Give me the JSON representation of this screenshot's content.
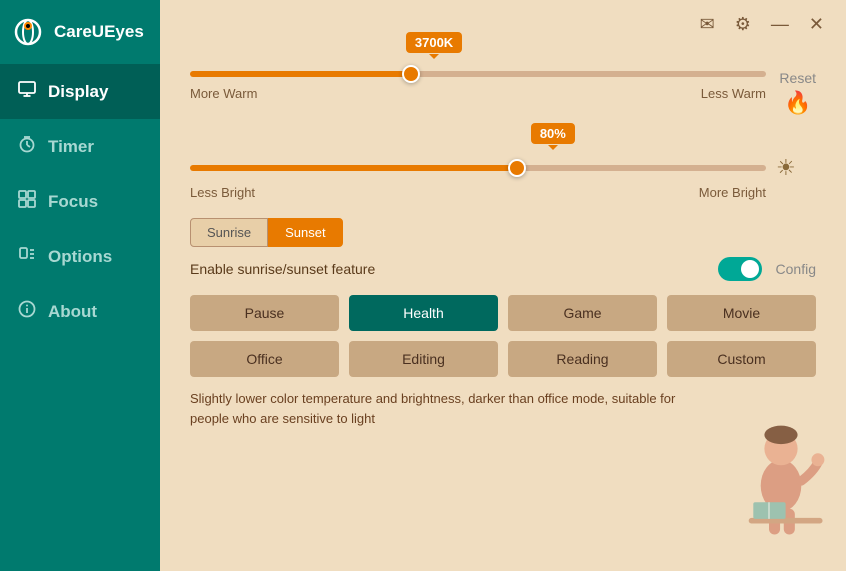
{
  "app": {
    "title": "CareUEyes"
  },
  "sidebar": {
    "items": [
      {
        "id": "display",
        "label": "Display",
        "icon": "🖥",
        "active": true
      },
      {
        "id": "timer",
        "label": "Timer",
        "icon": "🕐",
        "active": false
      },
      {
        "id": "focus",
        "label": "Focus",
        "icon": "⊞",
        "active": false
      },
      {
        "id": "options",
        "label": "Options",
        "icon": "🖱",
        "active": false
      },
      {
        "id": "about",
        "label": "About",
        "icon": "ℹ",
        "active": false
      }
    ]
  },
  "titlebar": {
    "mail_label": "✉",
    "settings_label": "⚙",
    "minimize_label": "—",
    "close_label": "✕"
  },
  "display": {
    "temp_bubble": "3700K",
    "temp_label_warm": "More Warm",
    "temp_label_less": "Less Warm",
    "bright_bubble": "80%",
    "bright_label_less": "Less Bright",
    "bright_label_more": "More Bright",
    "reset_label": "Reset",
    "sunrise_btn": "Sunrise",
    "sunset_btn": "Sunset",
    "enable_label": "Enable sunrise/sunset feature",
    "config_label": "Config",
    "modes": [
      {
        "id": "pause",
        "label": "Pause",
        "active": false
      },
      {
        "id": "health",
        "label": "Health",
        "active": true
      },
      {
        "id": "game",
        "label": "Game",
        "active": false
      },
      {
        "id": "movie",
        "label": "Movie",
        "active": false
      },
      {
        "id": "office",
        "label": "Office",
        "active": false
      },
      {
        "id": "editing",
        "label": "Editing",
        "active": false
      },
      {
        "id": "reading",
        "label": "Reading",
        "active": false
      },
      {
        "id": "custom",
        "label": "Custom",
        "active": false
      }
    ],
    "description": "Slightly lower color temperature and brightness, darker than office mode, suitable for people who are sensitive to light"
  }
}
